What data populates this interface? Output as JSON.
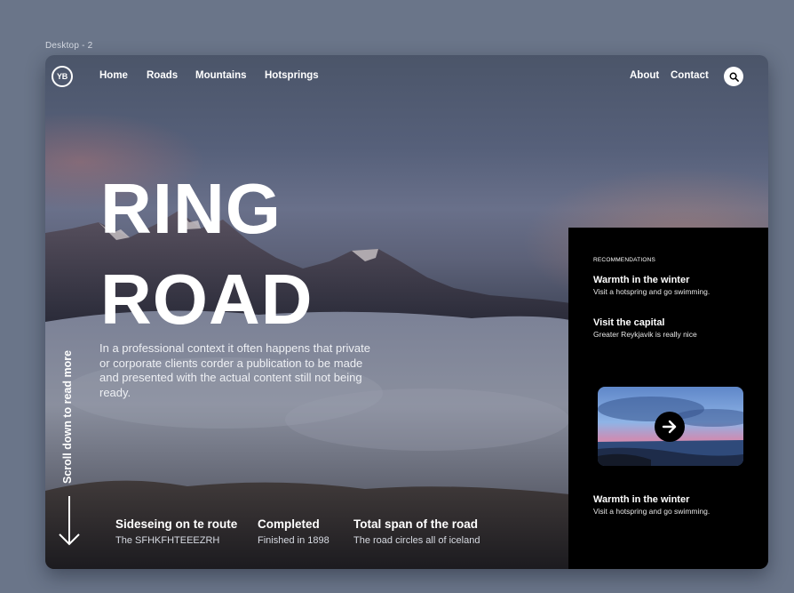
{
  "frame_label": "Desktop - 2",
  "nav": {
    "logo_text": "YB",
    "links": [
      "Home",
      "Roads",
      "Mountains",
      "Hotsprings"
    ],
    "right_links": [
      "About",
      "Contact"
    ],
    "search_icon": "search-icon"
  },
  "hero": {
    "title_line1": "RING",
    "title_line2": "ROAD",
    "body": "In a professional context it often happens that private or corporate clients corder a publication to be made and presented with the actual content still not being ready.",
    "scroll_text": "Scroll down to read more",
    "scroll_icon": "arrow-down-icon"
  },
  "stats": [
    {
      "title": "Sideseing on te route",
      "sub": "The SFHKFHTEEEZRH"
    },
    {
      "title": "Completed",
      "sub": "Finished in 1898"
    },
    {
      "title": "Total span of the road",
      "sub": "The road circles all of iceland"
    }
  ],
  "recommendations": {
    "label": "RECOMMENDATIONS",
    "items": [
      {
        "title": "Warmth in the winter",
        "sub": "Visit a hotspring and go swimming."
      },
      {
        "title": "Visit the capital",
        "sub": "Greater Reykjavik is really nice"
      },
      {
        "title": "Warmth in the winter",
        "sub": "Visit a hotspring and go swimming."
      }
    ],
    "image_arrow_icon": "arrow-right-icon"
  },
  "colors": {
    "page_background": "#6a7589",
    "panel_background": "#000000",
    "text": "#ffffff"
  }
}
